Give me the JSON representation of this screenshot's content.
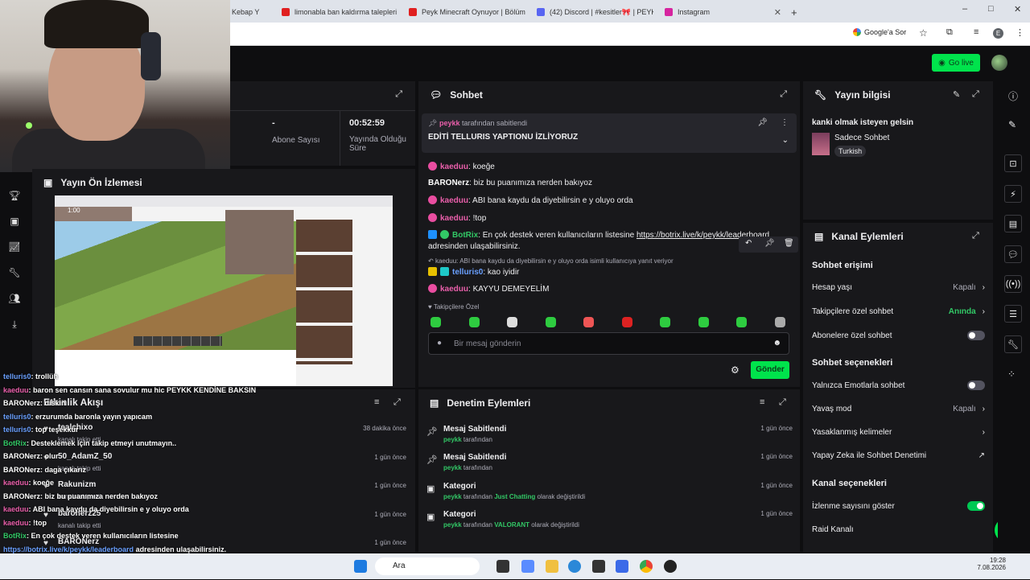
{
  "browser": {
    "tabs": [
      {
        "label": "Kebap Y",
        "color": "#e33"
      },
      {
        "label": "limonabla ban kaldırma talepleri",
        "color": "#e02020"
      },
      {
        "label": "Peyk Minecraft Oynuyor | Bölüm",
        "color": "#e02020"
      },
      {
        "label": "(42) Discord | #kesitler🎀 | PEYK",
        "color": "#5865f2"
      },
      {
        "label": "Instagram",
        "color": "#d6249f"
      }
    ],
    "new_tab": "+",
    "google_sor": "Google'a Sor",
    "profile_initial": "E",
    "win_min": "–",
    "win_max": "□",
    "win_close": "✕"
  },
  "header": {
    "go_live": "Go live"
  },
  "stats": {
    "abone_value": "-",
    "abone_label": "Abone Sayısı",
    "sure_value": "00:52:59",
    "sure_label": "Yayında Olduğu Süre"
  },
  "preview": {
    "title": "Yayın Ön İzlemesi",
    "timer": "1:00"
  },
  "activity": {
    "title": "Etkinlik Akışı",
    "items": [
      {
        "name": "tealchixo",
        "sub": "kanalı takip etti",
        "time": "38 dakika önce"
      },
      {
        "name": "50_AdamZ_50",
        "sub": "kanalı takip etti",
        "time": "1 gün önce"
      },
      {
        "name": "Rakunizm",
        "sub": "kanalı takip etti",
        "time": "1 gün önce"
      },
      {
        "name": "baronerz25",
        "sub": "kanalı takip etti",
        "time": "1 gün önce"
      },
      {
        "name": "BARONerz",
        "sub": "",
        "time": "1 gün önce"
      }
    ]
  },
  "chat": {
    "title": "Sohbet",
    "pinned_by_user": "peykk",
    "pinned_by_text": "tarafından sabitlendi",
    "pinned_message": "EDİTİ TELLURIS YAPTIONU İZLİYORUZ",
    "messages": [
      {
        "user": "kaeduu",
        "text": ": koeğe",
        "cls": "pink"
      },
      {
        "user": "BARONerz",
        "text": ": biz bu puanımıza nerden bakıyoz",
        "cls": "wht"
      },
      {
        "user": "kaeduu",
        "text": ": ABI bana kaydu da diyebilirsin e y oluyo orda",
        "cls": "pink"
      },
      {
        "user": "kaeduu",
        "text": ": !top",
        "cls": "pink"
      }
    ],
    "botrix_user": "BotRix",
    "botrix_text": ": En çok destek veren kullanıcıların listesine",
    "botrix_link": "https://botrix.live/k/peykk/leaderboard",
    "botrix_text2": "adresinden ulaşabilirsiniz.",
    "reply_context": "kaeduu: ABI bana kaydu da diyebilirsin e y oluyo orda isimli kullanıcıya yanıt veriyor",
    "reply_user": "telluris0",
    "reply_text": ": kao iyidir",
    "last_user": "kaeduu",
    "last_text": ": KAYYU DEMEYELİM",
    "follower_label": "Takipçilere Özel",
    "input_placeholder": "Bir mesaj gönderin",
    "send": "Gönder",
    "emote_colors": [
      "#2ecc40",
      "#2ecc40",
      "#ddd",
      "#2ecc40",
      "#e55",
      "#d22",
      "#2ecc40",
      "#2ecc40",
      "#2ecc40",
      "#aaa"
    ]
  },
  "moderation": {
    "title": "Denetim Eylemleri",
    "items": [
      {
        "title": "Mesaj Sabitlendi",
        "user": "peykk",
        "pre": "tarafından",
        "post": "",
        "time": "1 gün önce"
      },
      {
        "title": "Mesaj Sabitlendi",
        "user": "peykk",
        "pre": "tarafından",
        "post": "",
        "time": "1 gün önce"
      },
      {
        "title": "Kategori",
        "user": "peykk",
        "pre": "tarafından",
        "hl": "Just Chatting",
        "post": "olarak değiştirildi",
        "time": "1 gün önce"
      },
      {
        "title": "Kategori",
        "user": "peykk",
        "pre": "tarafından",
        "hl": "VALORANT",
        "post": "olarak değiştirildi",
        "time": "1 gün önce"
      }
    ]
  },
  "stream_info": {
    "title": "Yayın bilgisi",
    "stream_title": "kanki olmak isteyen gelsin",
    "category": "Sadece Sohbet",
    "language": "Turkish"
  },
  "channel_actions": {
    "title": "Kanal Eylemleri",
    "chat_access": "Sohbet erişimi",
    "account_age": "Hesap yaşı",
    "account_age_val": "Kapalı",
    "followers_only": "Takipçilere özel sohbet",
    "followers_only_val": "Anında",
    "subs_only": "Abonelere özel sohbet",
    "chat_options": "Sohbet seçenekleri",
    "emote_only": "Yalnızca Emotlarla sohbet",
    "slow_mode": "Yavaş mod",
    "slow_mode_val": "Kapalı",
    "banned_words": "Yasaklanmış kelimeler",
    "ai_mod": "Yapay Zeka ile Sohbet Denetimi",
    "channel_options": "Kanal seçenekleri",
    "show_views": "İzlenme sayısını göster",
    "raid": "Raid Kanalı"
  },
  "overlay_chat": [
    {
      "u": "telluris0",
      "t": ": trollüh",
      "c": "#6aa0ff"
    },
    {
      "u": "kaeduu",
      "t": ": baron sen cansın sana sovulur mu hic PEYKK KENDİNE BAKSIN",
      "c": "#ea5fab"
    },
    {
      "u": "BARONerz",
      "t": ": diskin",
      "c": "#fff"
    },
    {
      "u": "telluris0",
      "t": ": erzurumda baronla yayın yapıcam",
      "c": "#6aa0ff"
    },
    {
      "u": "telluris0",
      "t": ": top teşekkür",
      "c": "#6aa0ff"
    },
    {
      "u": "BotRix",
      "t": ": Desteklemek için takip etmeyi unutmayın..",
      "c": "#32c866"
    },
    {
      "u": "BARONerz",
      "t": ": olur",
      "c": "#fff"
    },
    {
      "u": "BARONerz",
      "t": ": daga çıkarız",
      "c": "#fff"
    },
    {
      "u": "kaeduu",
      "t": ": koeğe",
      "c": "#ea5fab"
    },
    {
      "u": "BARONerz",
      "t": ": biz bu puanımıza nerden bakıyoz",
      "c": "#fff"
    },
    {
      "u": "kaeduu",
      "t": ": ABI bana kaydu da diyebilirsin e y oluyo orda",
      "c": "#ea5fab"
    },
    {
      "u": "kaeduu",
      "t": ": !top",
      "c": "#ea5fab"
    },
    {
      "u": "BotRix",
      "t": ": En çok destek veren kullanıcıların listesine",
      "c": "#32c866"
    },
    {
      "u": "https://botrix.live/k/peykk/leaderboard",
      "t": " adresinden ulaşabilirsiniz.",
      "c": "#6aa0ff"
    },
    {
      "u": "telluris0",
      "t": ": kao iyidir",
      "c": "#6aa0ff"
    },
    {
      "u": "kaeduu",
      "t": ": KAYYU DEMEYELİM",
      "c": "#ea5fab"
    }
  ],
  "taskbar": {
    "search": "Ara",
    "time": "19:28",
    "date": "7.08.2026"
  }
}
